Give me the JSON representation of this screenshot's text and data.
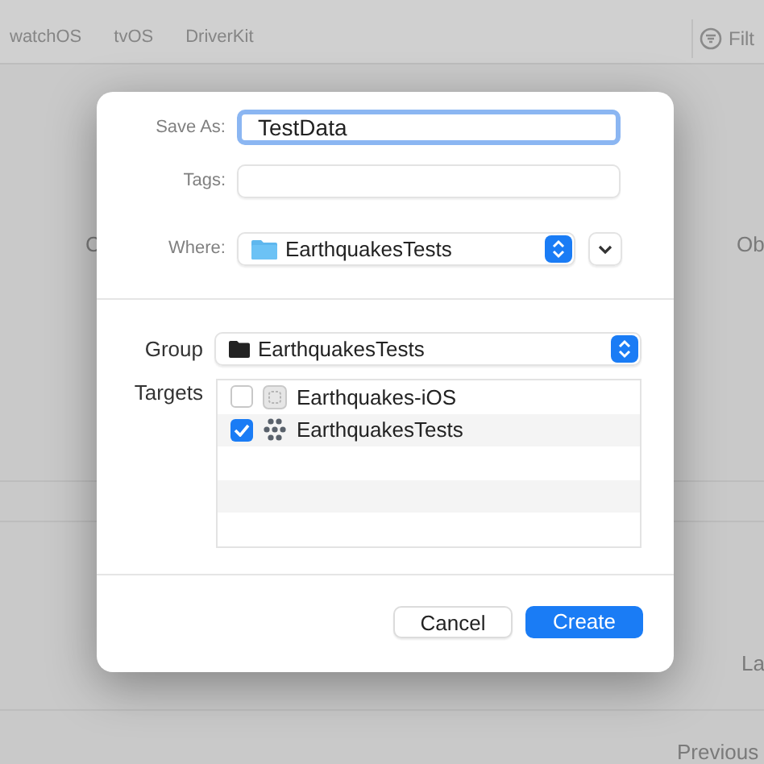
{
  "background": {
    "tabs": [
      {
        "label": "watchOS"
      },
      {
        "label": "tvOS"
      },
      {
        "label": "DriverKit"
      }
    ],
    "filter": {
      "placeholder": "Filt"
    },
    "fragments": [
      {
        "text": "C"
      },
      {
        "text": "Ob"
      },
      {
        "text": "La"
      },
      {
        "text": "Previous"
      }
    ]
  },
  "dialog": {
    "save_as": {
      "label": "Save As:",
      "value": "TestData",
      "focused": true
    },
    "tags": {
      "label": "Tags:"
    },
    "where": {
      "label": "Where:",
      "value": "EarthquakesTests"
    },
    "group": {
      "label": "Group",
      "value": "EarthquakesTests"
    },
    "targets": {
      "label": "Targets",
      "items": [
        {
          "name": "Earthquakes-iOS",
          "checked": false,
          "kind": "app"
        },
        {
          "name": "EarthquakesTests",
          "checked": true,
          "kind": "tests"
        }
      ]
    },
    "buttons": [
      {
        "label": "Cancel",
        "kind": "secondary"
      },
      {
        "label": "Create",
        "kind": "primary"
      }
    ]
  }
}
